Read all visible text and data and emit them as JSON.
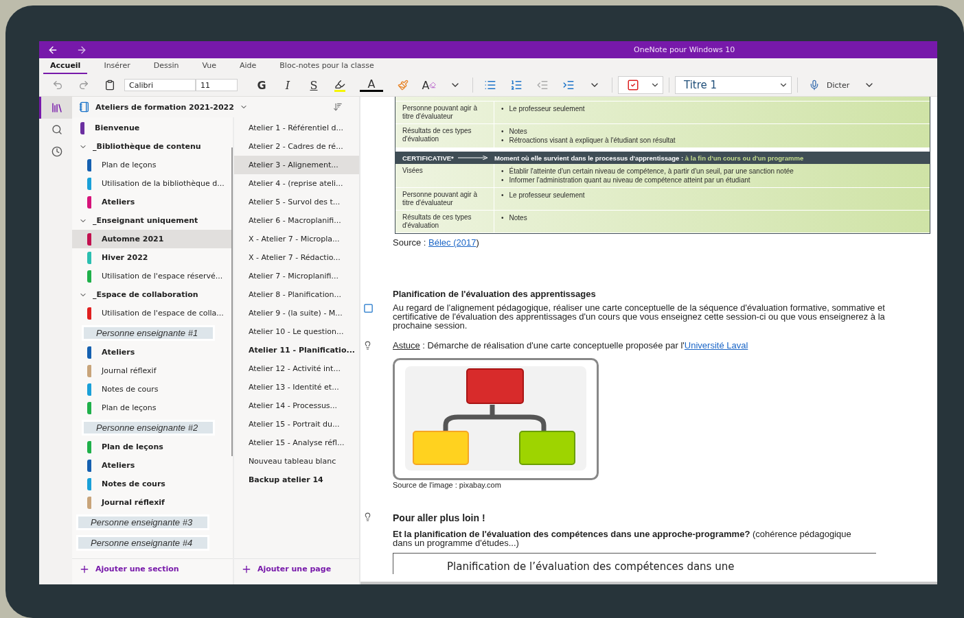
{
  "window": {
    "title": "OneNote pour Windows 10"
  },
  "ribbon_tabs": [
    {
      "label": "Accueil",
      "selected": true
    },
    {
      "label": "Insérer",
      "selected": false
    },
    {
      "label": "Dessin",
      "selected": false
    },
    {
      "label": "Vue",
      "selected": false
    },
    {
      "label": "Aide",
      "selected": false
    },
    {
      "label": "Bloc-notes pour la classe",
      "selected": false
    }
  ],
  "toolbar": {
    "font": "Calibri",
    "size": "11",
    "format_buttons": [
      {
        "kind": "bold",
        "glyph": "G"
      },
      {
        "kind": "italic",
        "glyph": "I"
      },
      {
        "kind": "underline",
        "glyph": "S"
      }
    ],
    "font_color_glyph": "A",
    "clear_format_glyph": "A",
    "tag": {
      "checked": true
    },
    "style": "Titre 1",
    "dictate": "Dicter"
  },
  "rail": [
    {
      "kind": "notebooks",
      "selected": true
    },
    {
      "kind": "search",
      "selected": false
    },
    {
      "kind": "recent",
      "selected": false
    }
  ],
  "notebook": {
    "title": "Ateliers de formation 2021-2022"
  },
  "sections": [
    {
      "kind": "section",
      "label": "Bienvenue",
      "color": "#6b2fa0",
      "unread": true,
      "selected": false
    },
    {
      "kind": "group",
      "label": "_Bibliothèque de contenu",
      "expanded": true,
      "children": [
        {
          "kind": "section",
          "label": "Plan de leçons",
          "color": "#1560b0",
          "unread": false,
          "selected": false
        },
        {
          "kind": "section",
          "label": "Utilisation de la bibliothèque d...",
          "color": "#1aa0d8",
          "unread": false,
          "selected": false
        },
        {
          "kind": "section",
          "label": "Ateliers",
          "color": "#d6137a",
          "unread": true,
          "selected": false
        }
      ]
    },
    {
      "kind": "group",
      "label": "_Enseignant uniquement",
      "expanded": true,
      "children": [
        {
          "kind": "section",
          "label": "Automne 2021",
          "color": "#c2114f",
          "unread": true,
          "selected": true
        },
        {
          "kind": "section",
          "label": "Hiver 2022",
          "color": "#2bbfb0",
          "unread": true,
          "selected": false
        },
        {
          "kind": "section",
          "label": "Utilisation de l'espace réservé...",
          "color": "#1fb04a",
          "unread": false,
          "selected": false
        }
      ]
    },
    {
      "kind": "group",
      "label": "_Espace de collaboration",
      "expanded": true,
      "children": [
        {
          "kind": "section",
          "label": "Utilisation de l'espace de colla...",
          "color": "#e02020",
          "unread": false,
          "selected": false
        }
      ]
    },
    {
      "kind": "highlight_group",
      "label": "Personne enseignante #1",
      "children": [
        {
          "kind": "section",
          "label": "Ateliers",
          "color": "#1560b0",
          "unread": true,
          "selected": false
        },
        {
          "kind": "section",
          "label": "Journal réflexif",
          "color": "#c8a47a",
          "unread": false,
          "selected": false
        },
        {
          "kind": "section",
          "label": "Notes de cours",
          "color": "#1aa0d8",
          "unread": false,
          "selected": false
        },
        {
          "kind": "section",
          "label": "Plan de leçons",
          "color": "#1fb04a",
          "unread": false,
          "selected": false
        }
      ]
    },
    {
      "kind": "highlight_group",
      "label": "Personne enseignante #2",
      "children": [
        {
          "kind": "section",
          "label": "Plan de leçons",
          "color": "#1fb04a",
          "unread": true,
          "selected": false
        },
        {
          "kind": "section",
          "label": "Ateliers",
          "color": "#1560b0",
          "unread": true,
          "selected": false
        },
        {
          "kind": "section",
          "label": "Notes de cours",
          "color": "#1aa0d8",
          "unread": true,
          "selected": false
        },
        {
          "kind": "section",
          "label": "Journal réflexif",
          "color": "#c8a47a",
          "unread": true,
          "selected": false
        }
      ]
    },
    {
      "kind": "highlight_group",
      "label": "Personne enseignante #3"
    },
    {
      "kind": "highlight_group",
      "label": "Personne enseignante #4"
    }
  ],
  "add_section": "Ajouter une section",
  "pages": [
    {
      "title": "Atelier 1 - Référentiel d...",
      "selected": false,
      "unread": false
    },
    {
      "title": "Atelier 2 - Cadres de ré...",
      "selected": false,
      "unread": false
    },
    {
      "title": "Atelier 3 - Alignement...",
      "selected": true,
      "unread": false
    },
    {
      "title": "Atelier 4 - (reprise ateli...",
      "selected": false,
      "unread": false
    },
    {
      "title": "Atelier 5 - Survol des t...",
      "selected": false,
      "unread": false
    },
    {
      "title": "Atelier 6 - Macroplanifi...",
      "selected": false,
      "unread": false
    },
    {
      "title": "X - Atelier 7 - Micropla...",
      "selected": false,
      "unread": false
    },
    {
      "title": "X - Atelier 7 - Rédactio...",
      "selected": false,
      "unread": false
    },
    {
      "title": "Atelier 7 - Microplanifi...",
      "selected": false,
      "unread": false
    },
    {
      "title": "Atelier 8 - Planification...",
      "selected": false,
      "unread": false
    },
    {
      "title": "Atelier 9 - (la suite) - M...",
      "selected": false,
      "unread": false
    },
    {
      "title": "Atelier 10 - Le question...",
      "selected": false,
      "unread": false
    },
    {
      "title": "Atelier 11 - Planificatio...",
      "selected": false,
      "unread": true
    },
    {
      "title": "Atelier 12 - Activité int...",
      "selected": false,
      "unread": false
    },
    {
      "title": "Atelier 13 - Identité et...",
      "selected": false,
      "unread": false
    },
    {
      "title": "Atelier 14 - Processus...",
      "selected": false,
      "unread": false
    },
    {
      "title": "Atelier 15 - Portrait du...",
      "selected": false,
      "unread": false
    },
    {
      "title": "Atelier 15 - Analyse réfl...",
      "selected": false,
      "unread": false
    },
    {
      "title": "Nouveau tableau blanc",
      "selected": false,
      "unread": false
    },
    {
      "title": "Backup atelier 14",
      "selected": false,
      "unread": true
    }
  ],
  "add_page": "Ajouter une page",
  "table_bullet": "•",
  "evaluation_table": [
    {
      "kind": "row",
      "label": "Personne pouvant agir à titre d'évaluateur",
      "bullets": [
        "Le professeur seulement"
      ]
    },
    {
      "kind": "row",
      "label": "Résultats de ces types d'évaluation",
      "bullets": [
        "Notes",
        "Rétroactions visant à expliquer à l'étudiant son résultat"
      ]
    },
    {
      "kind": "header",
      "label": "CERTIFICATIVE*",
      "text": "Moment où elle survient dans le processus d'apprentissage :",
      "highlight": "à la fin d'un cours ou d'un programme"
    },
    {
      "kind": "row",
      "label": "Visées",
      "bullets": [
        "Établir l'atteinte d'un certain niveau de compétence, à partir d'un seuil, par une sanction notée",
        "Informer l'administration quant au niveau de compétence atteint par un étudiant"
      ]
    },
    {
      "kind": "row",
      "label": "Personne pouvant agir à titre d'évaluateur",
      "bullets": [
        "Le professeur seulement"
      ]
    },
    {
      "kind": "row",
      "label": "Résultats de ces types d'évaluation",
      "bullets": [
        "Notes"
      ]
    }
  ],
  "source": {
    "prefix": "Source : ",
    "link": "Bélec (2017",
    "suffix": ")"
  },
  "task": {
    "heading": "Planification de l'évaluation des apprentissages",
    "text": "Au regard de l'alignement pédagogique, réaliser une carte conceptuelle de la séquence d'évaluation formative, sommative et certificative de l'évaluation des apprentissages d'un cours que vous enseignez cette session-ci ou que vous enseignerez à la prochaine session.",
    "checked": false
  },
  "tip": {
    "label": "Astuce",
    "text": " : Démarche de réalisation d'une carte conceptuelle proposée par l'",
    "link": "Université Laval"
  },
  "image_caption": "Source de l'image : pixabay.com",
  "further": {
    "heading": "Pour aller plus loin !",
    "text": "**Et la planification de l'évaluation des compétences dans une approche-programme?**  (cohérence pédagogique dans un programme d'études...)",
    "embedded_title": "Planification de l’évaluation des compétences dans une"
  }
}
